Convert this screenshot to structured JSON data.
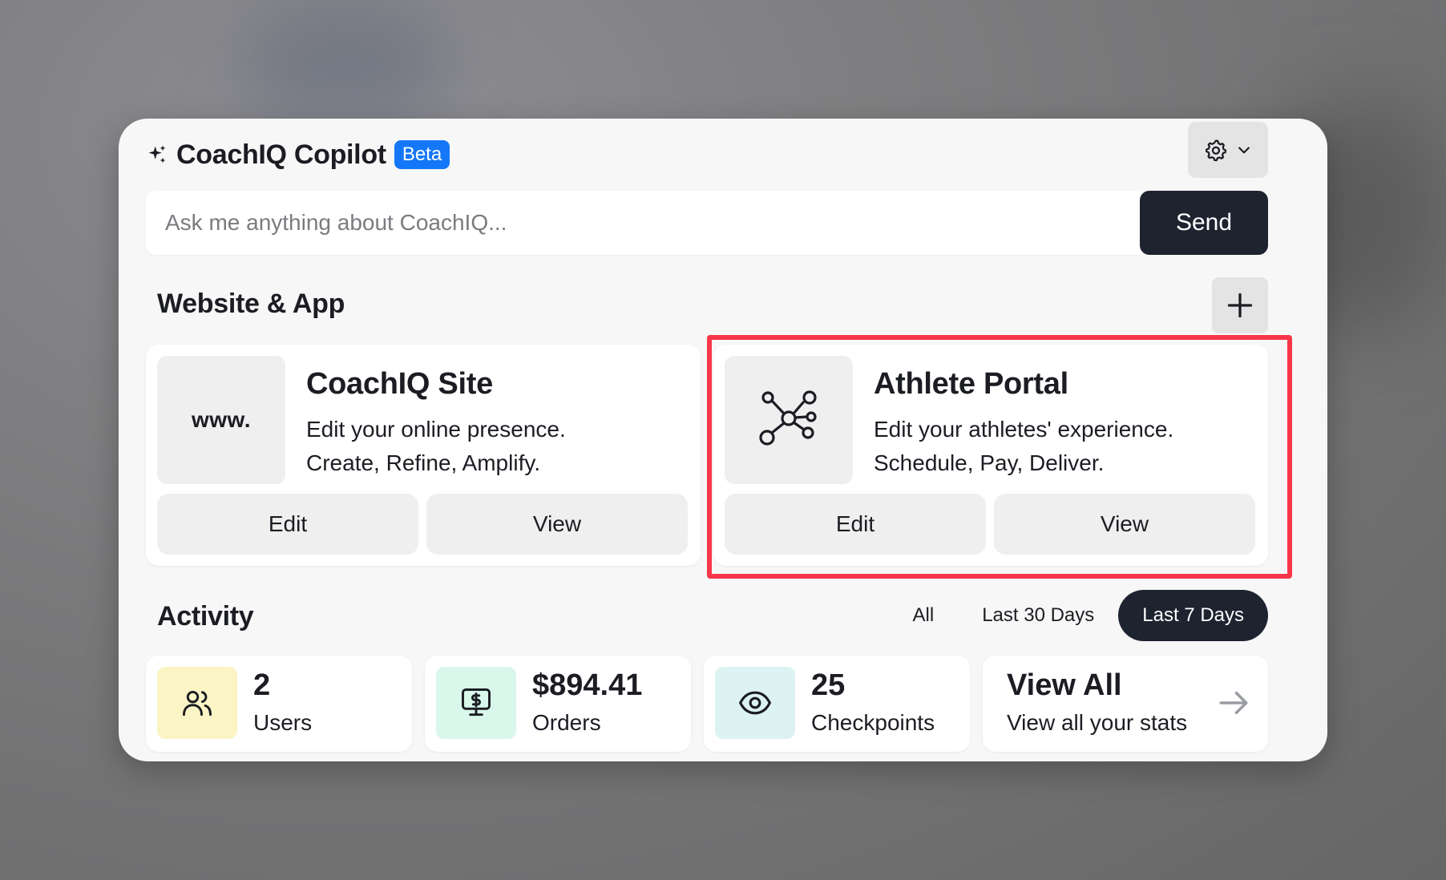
{
  "header": {
    "title": "CoachIQ Copilot",
    "badge": "Beta"
  },
  "icons": {
    "sparkle": "sparkle-icon",
    "settings": "gear-icon",
    "chevron": "chevron-down-icon",
    "plus": "plus-icon",
    "network": "network-icon",
    "users": "users-icon",
    "orders": "dollar-monitor-icon",
    "checkpoints": "eye-icon",
    "arrow": "arrow-right-icon"
  },
  "ask": {
    "placeholder": "Ask me anything about CoachIQ...",
    "send_label": "Send"
  },
  "website": {
    "title": "Website & App",
    "cards": [
      {
        "thumb_text": "www.",
        "title": "CoachIQ Site",
        "line1": "Edit your online presence.",
        "line2": "Create, Refine, Amplify.",
        "edit": "Edit",
        "view": "View"
      },
      {
        "title": "Athlete Portal",
        "line1": "Edit your athletes' experience.",
        "line2": "Schedule, Pay, Deliver.",
        "edit": "Edit",
        "view": "View"
      }
    ]
  },
  "activity": {
    "title": "Activity",
    "filters": [
      "All",
      "Last 30 Days",
      "Last 7 Days"
    ],
    "active_filter": "Last 7 Days",
    "stats": [
      {
        "value": "2",
        "label": "Users",
        "bg": "#fbf4c4"
      },
      {
        "value": "$894.41",
        "label": "Orders",
        "bg": "#d9f7ea"
      },
      {
        "value": "25",
        "label": "Checkpoints",
        "bg": "#ddf2f2"
      },
      {
        "value": "View All",
        "label": "View all your stats"
      }
    ]
  },
  "colors": {
    "accent": "#1477f8",
    "dark": "#1e2330",
    "highlight": "#f8364a"
  }
}
